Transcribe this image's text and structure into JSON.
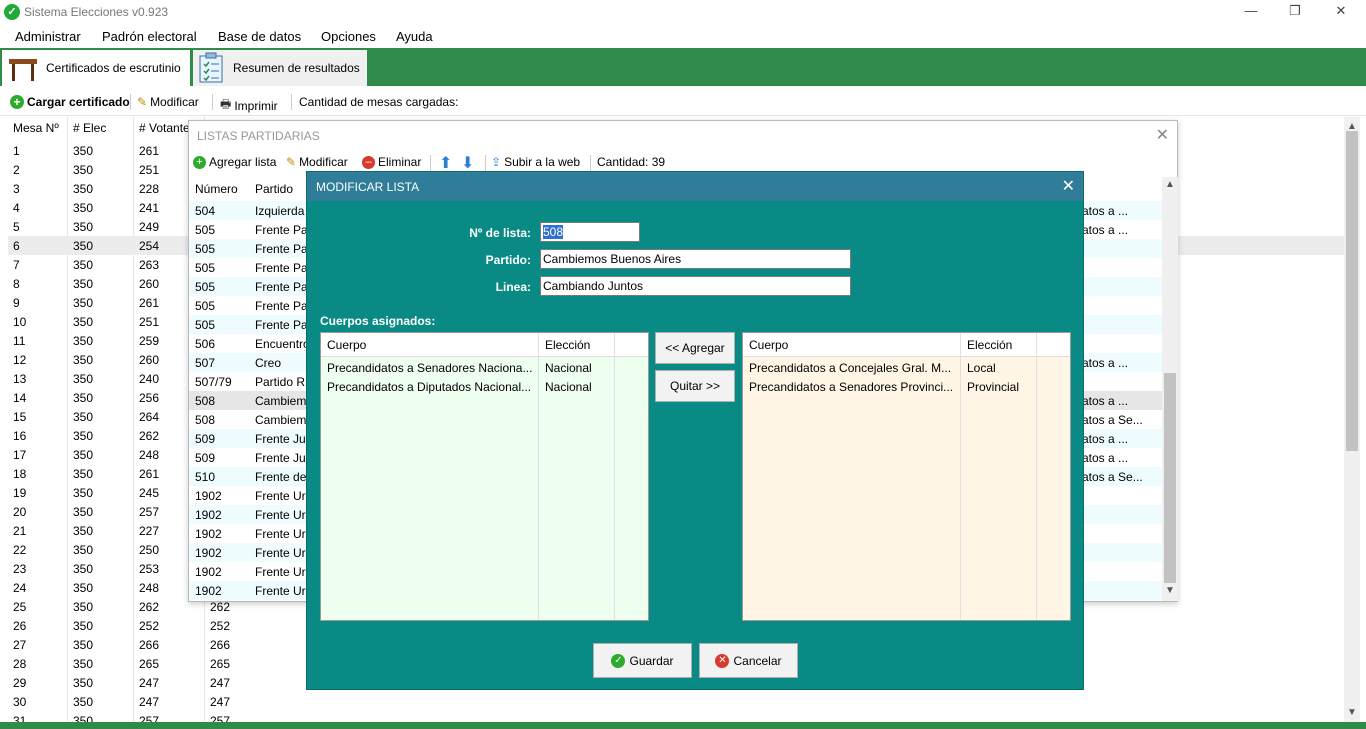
{
  "window": {
    "title": "Sistema Elecciones v0.923",
    "minimize": "—",
    "restore": "❐",
    "close": "✕"
  },
  "menu": [
    "Administrar",
    "Padrón electoral",
    "Base de datos",
    "Opciones",
    "Ayuda"
  ],
  "tabs": [
    {
      "label": "Certificados de escrutinio"
    },
    {
      "label": "Resumen de resultados"
    }
  ],
  "toolbar": {
    "load": "Cargar certificado",
    "edit": "Modificar",
    "print": "Imprimir",
    "count": "Cantidad de mesas cargadas:"
  },
  "grid": {
    "headers": [
      "Mesa Nº",
      "# Elec",
      "# Votante"
    ],
    "rows": [
      [
        "1",
        "350",
        "261",
        ""
      ],
      [
        "2",
        "350",
        "251",
        ""
      ],
      [
        "3",
        "350",
        "228",
        ""
      ],
      [
        "4",
        "350",
        "241",
        ""
      ],
      [
        "5",
        "350",
        "249",
        ""
      ],
      [
        "6",
        "350",
        "254",
        ""
      ],
      [
        "7",
        "350",
        "263",
        ""
      ],
      [
        "8",
        "350",
        "260",
        ""
      ],
      [
        "9",
        "350",
        "261",
        ""
      ],
      [
        "10",
        "350",
        "251",
        ""
      ],
      [
        "11",
        "350",
        "259",
        ""
      ],
      [
        "12",
        "350",
        "260",
        ""
      ],
      [
        "13",
        "350",
        "240",
        ""
      ],
      [
        "14",
        "350",
        "256",
        ""
      ],
      [
        "15",
        "350",
        "264",
        ""
      ],
      [
        "16",
        "350",
        "262",
        ""
      ],
      [
        "17",
        "350",
        "248",
        ""
      ],
      [
        "18",
        "350",
        "261",
        ""
      ],
      [
        "19",
        "350",
        "245",
        ""
      ],
      [
        "20",
        "350",
        "257",
        ""
      ],
      [
        "21",
        "350",
        "227",
        ""
      ],
      [
        "22",
        "350",
        "250",
        ""
      ],
      [
        "23",
        "350",
        "253",
        ""
      ],
      [
        "24",
        "350",
        "248",
        ""
      ],
      [
        "25",
        "350",
        "262",
        "262"
      ],
      [
        "26",
        "350",
        "252",
        "252"
      ],
      [
        "27",
        "350",
        "266",
        "266"
      ],
      [
        "28",
        "350",
        "265",
        "265"
      ],
      [
        "29",
        "350",
        "247",
        "247"
      ],
      [
        "30",
        "350",
        "247",
        "247"
      ],
      [
        "31",
        "350",
        "257",
        "257"
      ]
    ]
  },
  "listas": {
    "title": "LISTAS PARTIDARIAS",
    "close": "✕",
    "toolbar": {
      "add": "Agregar lista",
      "edit": "Modificar",
      "delete": "Eliminar",
      "upload": "Subir a la web",
      "count": "Cantidad: 39"
    },
    "headers": [
      "Número",
      "Partido"
    ],
    "rows": [
      [
        "504",
        "Izquierda",
        "atos a ..."
      ],
      [
        "505",
        "Frente Pa",
        "atos a ..."
      ],
      [
        "505",
        "Frente Pa",
        ""
      ],
      [
        "505",
        "Frente Pa",
        ""
      ],
      [
        "505",
        "Frente Pa",
        ""
      ],
      [
        "505",
        "Frente Pa",
        ""
      ],
      [
        "505",
        "Frente Pa",
        ""
      ],
      [
        "506",
        "Encuentro",
        ""
      ],
      [
        "507",
        "Creo",
        "atos a ..."
      ],
      [
        "507/79",
        "Partido R",
        ""
      ],
      [
        "508",
        "Cambiem",
        "atos a ..."
      ],
      [
        "508",
        "Cambiem",
        "atos a Se..."
      ],
      [
        "509",
        "Frente Ju",
        "atos a ..."
      ],
      [
        "509",
        "Frente Ju",
        "atos a ..."
      ],
      [
        "510",
        "Frente de",
        "atos a Se..."
      ],
      [
        "1902",
        "Frente Ur",
        ""
      ],
      [
        "1902",
        "Frente Ur",
        ""
      ],
      [
        "1902",
        "Frente Ur",
        ""
      ],
      [
        "1902",
        "Frente Ur",
        ""
      ],
      [
        "1902",
        "Frente Ur",
        ""
      ],
      [
        "1902",
        "Frente Ur",
        ""
      ]
    ]
  },
  "dialog": {
    "title": "MODIFICAR LISTA",
    "close": "✕",
    "numero_label": "Nº de lista:",
    "numero_value": "508",
    "partido_label": "Partido:",
    "partido_value": "Cambiemos Buenos Aires",
    "linea_label": "Linea:",
    "linea_value": "Cambiando Juntos",
    "cuerpos_label": "Cuerpos asignados:",
    "list_headers": [
      "Cuerpo",
      "Elección"
    ],
    "assigned": [
      [
        "Precandidatos a Senadores Naciona...",
        "Nacional"
      ],
      [
        "Precandidatos a Diputados Nacional...",
        "Nacional"
      ]
    ],
    "available": [
      [
        "Precandidatos a Concejales Gral. M...",
        "Local"
      ],
      [
        "Precandidatos a Senadores Provinci...",
        "Provincial"
      ]
    ],
    "add_btn": "<< Agregar",
    "remove_btn": "Quitar >>",
    "save_btn": "Guardar",
    "cancel_btn": "Cancelar"
  }
}
